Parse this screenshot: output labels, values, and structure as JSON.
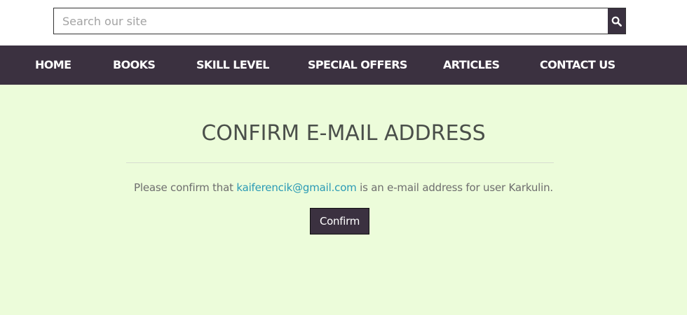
{
  "search": {
    "placeholder": "Search our site",
    "value": "",
    "button_icon": "search-icon"
  },
  "nav": {
    "items": [
      {
        "label": "HOME"
      },
      {
        "label": "BOOKS"
      },
      {
        "label": "SKILL LEVEL"
      },
      {
        "label": "SPECIAL OFFERS"
      },
      {
        "label": "ARTICLES"
      },
      {
        "label": "CONTACT US"
      }
    ]
  },
  "main": {
    "title": "CONFIRM E-MAIL ADDRESS",
    "message_prefix": "Please confirm that ",
    "email": "kaiferencik@gmail.com",
    "message_suffix": " is an e-mail address for user Karkulin.",
    "confirm_label": "Confirm"
  },
  "colors": {
    "nav_bg": "#3b3140",
    "content_bg": "#ecfcda",
    "link": "#2a9ab5",
    "title_text": "#4a4f4a"
  }
}
